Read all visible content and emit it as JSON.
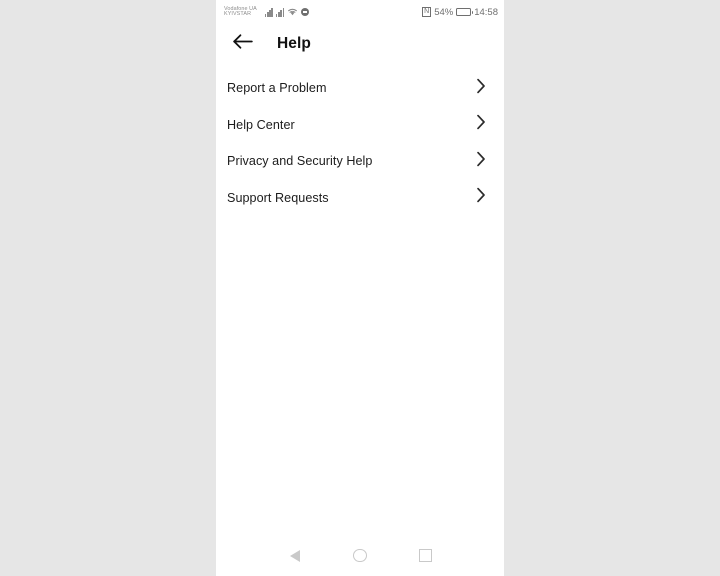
{
  "colors": {
    "backdrop": "#e6e6e6",
    "screen_bg": "#ffffff",
    "text_primary": "#1c1c1c",
    "status_icon": "#6f6f6f",
    "carrier_text": "#8d8d8d",
    "nav_icon": "#c9c9c9"
  },
  "status_bar": {
    "carrier_line1": "Vodafone UA",
    "carrier_line2": "KYIVSTAR",
    "signal_icon_1": "signal-bars-icon",
    "signal_icon_2": "signal-bars-icon",
    "wifi_icon": "wifi-icon",
    "dnd_icon": "do-not-disturb-icon",
    "nfc_icon": "nfc-icon",
    "battery_percent": "54%",
    "battery_level": 54,
    "battery_icon": "battery-icon",
    "clock": "14:58"
  },
  "app_bar": {
    "back_icon": "arrow-left-icon",
    "title": "Help"
  },
  "menu": {
    "items": [
      {
        "label": "Report a Problem",
        "chevron": "chevron-right-icon"
      },
      {
        "label": "Help Center",
        "chevron": "chevron-right-icon"
      },
      {
        "label": "Privacy and Security Help",
        "chevron": "chevron-right-icon"
      },
      {
        "label": "Support Requests",
        "chevron": "chevron-right-icon"
      }
    ]
  },
  "nav_bar": {
    "back_label": "back-triangle-icon",
    "home_label": "home-circle-icon",
    "recents_label": "recents-square-icon"
  }
}
